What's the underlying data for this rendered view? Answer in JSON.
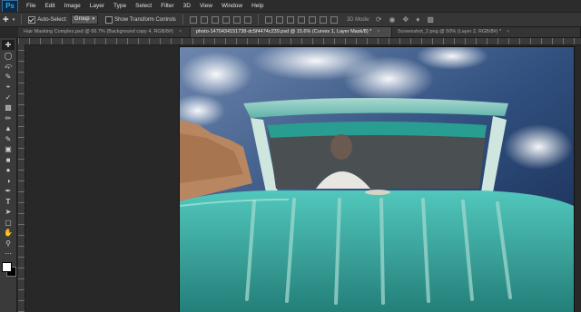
{
  "app": {
    "logo": "Ps"
  },
  "menubar": {
    "items": [
      "File",
      "Edit",
      "Image",
      "Layer",
      "Type",
      "Select",
      "Filter",
      "3D",
      "View",
      "Window",
      "Help"
    ]
  },
  "options_bar": {
    "auto_select_label": "Auto-Select:",
    "auto_select_checked": true,
    "auto_select_target": "Group",
    "show_transform_label": "Show Transform Controls",
    "show_transform_checked": false,
    "mode3d_label": "3D Mode:"
  },
  "tabs": [
    {
      "label": "Hair Masking Complex.psd @ 66.7% (Background copy 4, RGB/8#)",
      "active": false
    },
    {
      "label": "photo-1470434151738-dc5f4474c239.psd @ 15.6% (Curves 1, Layer Mask/8) *",
      "active": true
    },
    {
      "label": "Screenshot_2.png @ 50% (Layer 2, RGB/8#) *",
      "active": false
    }
  ],
  "toolbar": {
    "tools": [
      "move-tool",
      "marquee-tool",
      "lasso-tool",
      "quick-select-tool",
      "crop-tool",
      "eyedropper-tool",
      "healing-brush-tool",
      "brush-tool",
      "clone-stamp-tool",
      "history-brush-tool",
      "eraser-tool",
      "gradient-tool",
      "blur-tool",
      "dodge-tool",
      "pen-tool",
      "type-tool",
      "path-selection-tool",
      "shape-tool",
      "hand-tool",
      "zoom-tool"
    ]
  },
  "colors": {
    "foreground": "#ffffff",
    "background": "#000000",
    "car_body": "#3bb3a8",
    "sky": "#2f4f86"
  }
}
